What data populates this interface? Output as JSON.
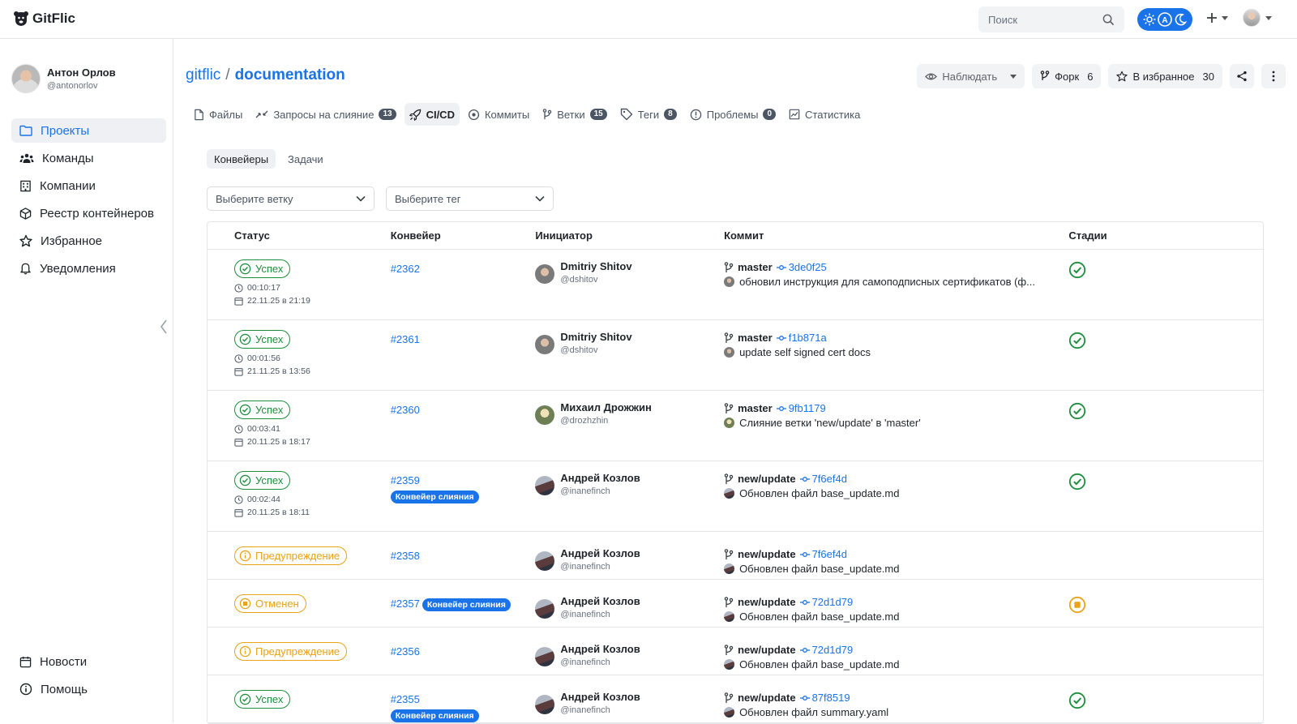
{
  "app": {
    "name": "GitFlic"
  },
  "topbar": {
    "search_placeholder": "Поиск"
  },
  "user": {
    "name": "Антон Орлов",
    "handle": "@antonorlov"
  },
  "sidebar": {
    "items": [
      {
        "label": "Проекты",
        "icon": "folder-icon",
        "active": true
      },
      {
        "label": "Команды",
        "icon": "team-icon"
      },
      {
        "label": "Компании",
        "icon": "building-icon"
      },
      {
        "label": "Реестр контейнеров",
        "icon": "cube-icon"
      },
      {
        "label": "Избранное",
        "icon": "star-icon"
      },
      {
        "label": "Уведомления",
        "icon": "bell-icon"
      }
    ],
    "bottom": [
      {
        "label": "Новости",
        "icon": "calendar-icon"
      },
      {
        "label": "Помощь",
        "icon": "info-icon"
      }
    ]
  },
  "repo": {
    "owner": "gitflic",
    "separator": "/",
    "name": "documentation",
    "watch_label": "Наблюдать",
    "fork_label": "Форк",
    "fork_count": "6",
    "fav_label": "В избранное",
    "fav_count": "30"
  },
  "tabs": [
    {
      "label": "Файлы"
    },
    {
      "label": "Запросы на слияние",
      "count": "13"
    },
    {
      "label": "CI/CD",
      "active": true
    },
    {
      "label": "Коммиты"
    },
    {
      "label": "Ветки",
      "count": "15"
    },
    {
      "label": "Теги",
      "count": "8"
    },
    {
      "label": "Проблемы",
      "count": "0"
    },
    {
      "label": "Статистика"
    }
  ],
  "subtabs": [
    {
      "label": "Конвейеры",
      "active": true
    },
    {
      "label": "Задачи"
    }
  ],
  "filters": {
    "branch_placeholder": "Выберите ветку",
    "tag_placeholder": "Выберите тег"
  },
  "table": {
    "headers": {
      "status": "Статус",
      "pipeline": "Конвейер",
      "initiator": "Инициатор",
      "commit": "Коммит",
      "stages": "Стадии"
    },
    "rows": [
      {
        "status": "Успех",
        "kind": "success",
        "duration": "00:10:17",
        "date": "22.11.25 в 21:19",
        "id": "#2362",
        "merge": "",
        "init_name": "Dmitriy Shitov",
        "init_handle": "@dshitov",
        "branch": "master",
        "sha": "3de0f25",
        "message": "обновил инструкция для самоподписных сертификатов (ф...",
        "stage": "success"
      },
      {
        "status": "Успех",
        "kind": "success",
        "duration": "00:01:56",
        "date": "21.11.25 в 13:56",
        "id": "#2361",
        "merge": "",
        "init_name": "Dmitriy Shitov",
        "init_handle": "@dshitov",
        "branch": "master",
        "sha": "f1b871a",
        "message": "update self signed cert docs",
        "stage": "success"
      },
      {
        "status": "Успех",
        "kind": "success",
        "duration": "00:03:41",
        "date": "20.11.25 в 18:17",
        "id": "#2360",
        "merge": "",
        "init_name": "Михаил Дрожжин",
        "init_handle": "@drozhzhin",
        "branch": "master",
        "sha": "9fb1179",
        "message": "Слияние ветки 'new/update' в 'master'",
        "stage": "success"
      },
      {
        "status": "Успех",
        "kind": "success",
        "duration": "00:02:44",
        "date": "20.11.25 в 18:11",
        "id": "#2359",
        "merge": "Конвейер слияния",
        "init_name": "Андрей Козлов",
        "init_handle": "@inanefinch",
        "branch": "new/update",
        "sha": "7f6ef4d",
        "message": "Обновлен файл base_update.md",
        "stage": "success"
      },
      {
        "status": "Предупреждение",
        "kind": "warning",
        "duration": "",
        "date": "",
        "id": "#2358",
        "merge": "",
        "init_name": "Андрей Козлов",
        "init_handle": "@inanefinch",
        "branch": "new/update",
        "sha": "7f6ef4d",
        "message": "Обновлен файл base_update.md",
        "stage": ""
      },
      {
        "status": "Отменен",
        "kind": "canceled",
        "duration": "",
        "date": "",
        "id": "#2357",
        "merge": "Конвейер слияния",
        "init_name": "Андрей Козлов",
        "init_handle": "@inanefinch",
        "branch": "new/update",
        "sha": "72d1d79",
        "message": "Обновлен файл base_update.md",
        "stage": "canceled"
      },
      {
        "status": "Предупреждение",
        "kind": "warning",
        "duration": "",
        "date": "",
        "id": "#2356",
        "merge": "",
        "init_name": "Андрей Козлов",
        "init_handle": "@inanefinch",
        "branch": "new/update",
        "sha": "72d1d79",
        "message": "Обновлен файл base_update.md",
        "stage": ""
      },
      {
        "status": "Успех",
        "kind": "success",
        "duration": "",
        "date": "",
        "id": "#2355",
        "merge": "Конвейер слияния",
        "init_name": "Андрей Козлов",
        "init_handle": "@inanefinch",
        "branch": "new/update",
        "sha": "87f8519",
        "message": "Обновлен файл summary.yaml",
        "stage": "success"
      }
    ]
  },
  "colors": {
    "accent": "#1a73e8",
    "success": "#1e8e3e",
    "warning": "#e8a317"
  }
}
